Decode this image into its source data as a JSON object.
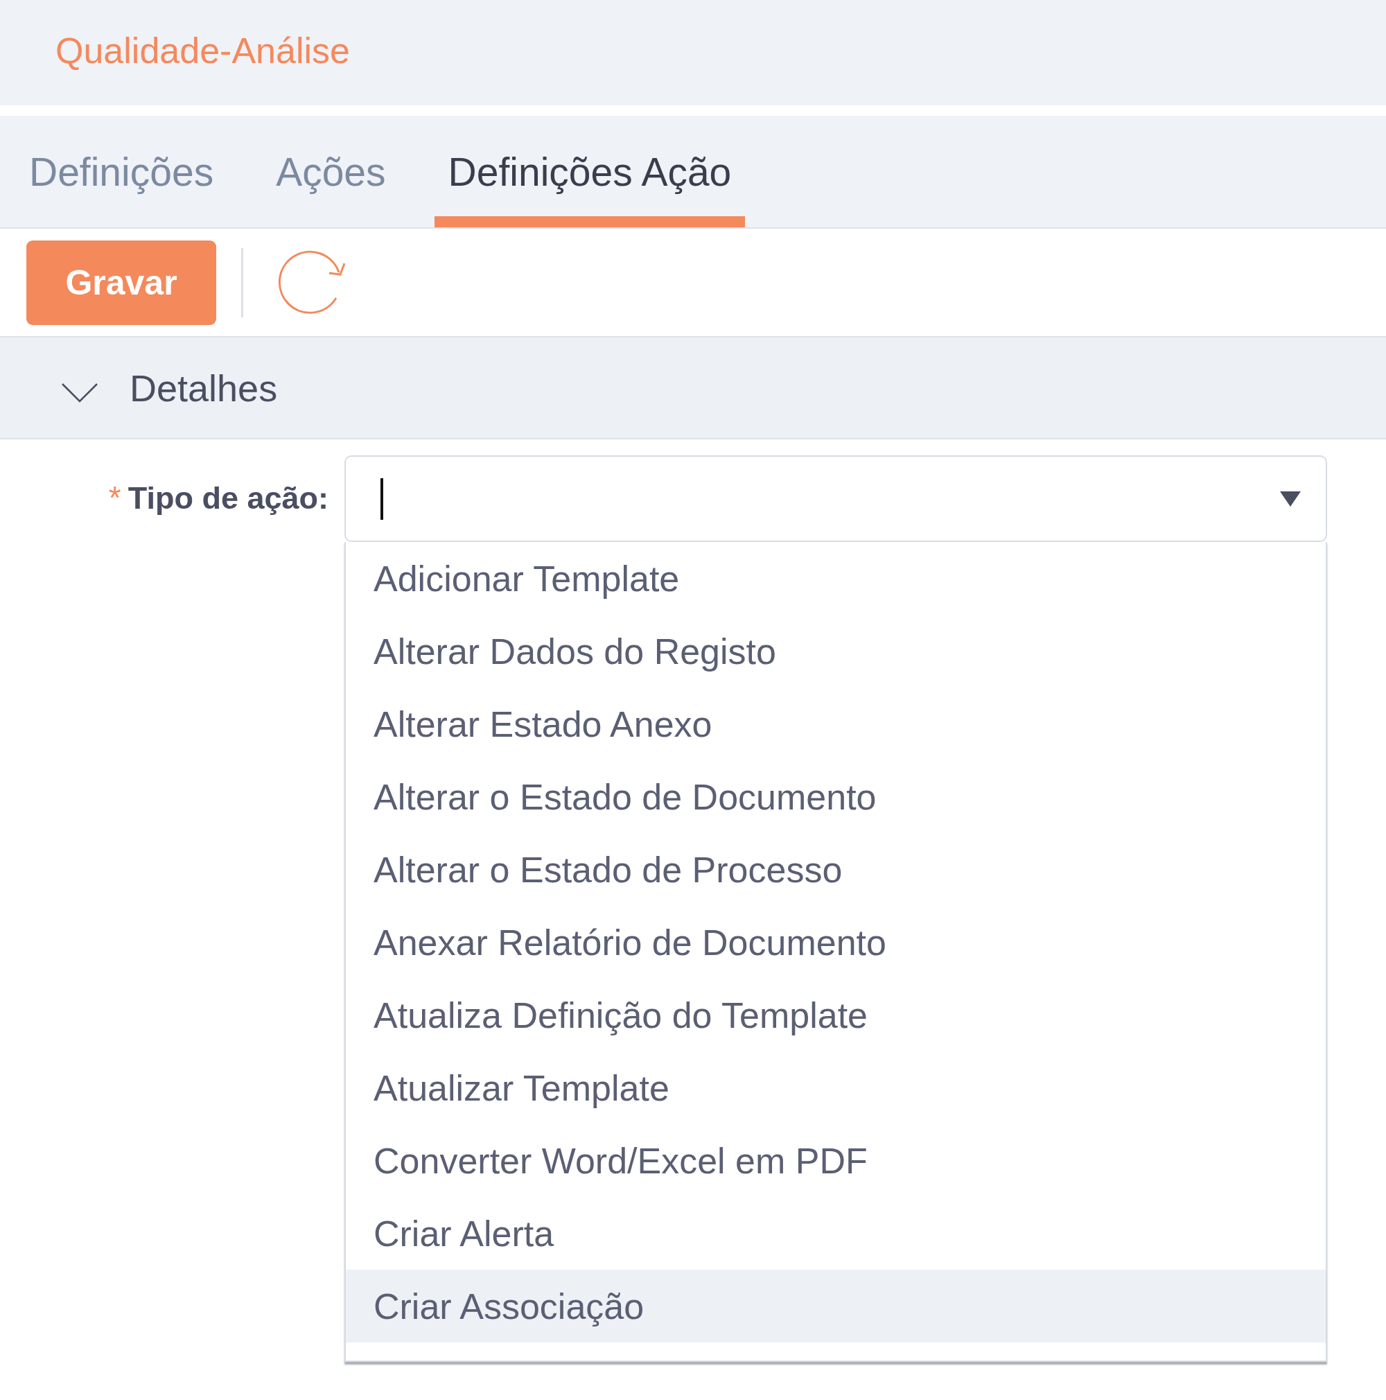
{
  "app_title": "Qualidade-Análise",
  "tabs": [
    {
      "label": "Definições",
      "selected": false
    },
    {
      "label": "Ações",
      "selected": false
    },
    {
      "label": "Definições Ação",
      "selected": true
    }
  ],
  "toolbar": {
    "save_button": "Gravar"
  },
  "section": {
    "title": "Detalhes",
    "expanded": true
  },
  "field": {
    "required_mark": "*",
    "label": "Tipo de ação:",
    "focused": true,
    "open": true,
    "options": [
      {
        "label": "Adicionar Template",
        "selected": false
      },
      {
        "label": "Alterar Dados do Registo",
        "selected": false
      },
      {
        "label": "Alterar Estado Anexo",
        "selected": false
      },
      {
        "label": "Alterar o Estado de Documento",
        "selected": false
      },
      {
        "label": "Alterar o Estado de Processo",
        "selected": false
      },
      {
        "label": "Anexar Relatório de Documento",
        "selected": false
      },
      {
        "label": "Atualiza Definição do Template",
        "selected": false
      },
      {
        "label": "Atualizar Template",
        "selected": false
      },
      {
        "label": "Converter Word/Excel em PDF",
        "selected": false
      },
      {
        "label": "Criar Alerta",
        "selected": false
      },
      {
        "label": "Criar Associação",
        "selected": true
      }
    ]
  }
}
